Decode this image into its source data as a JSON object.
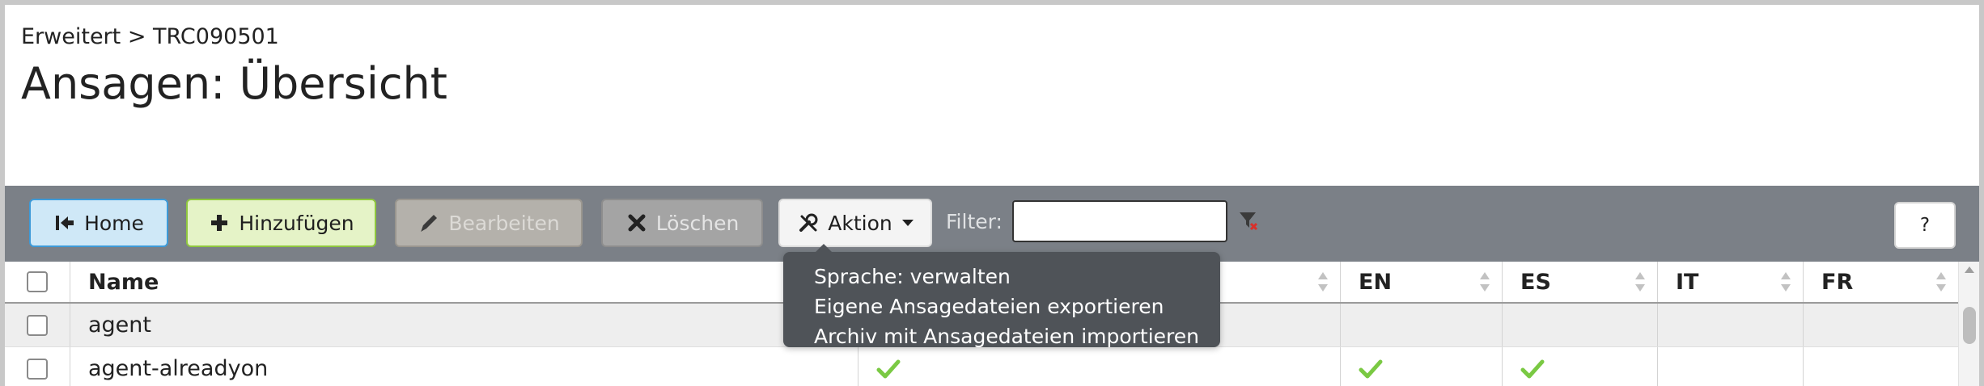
{
  "breadcrumb": "Erweitert > TRC090501",
  "title": "Ansagen: Übersicht",
  "toolbar": {
    "home_label": "Home",
    "add_label": "Hinzufügen",
    "edit_label": "Bearbeiten",
    "delete_label": "Löschen",
    "action_label": "Aktion",
    "filter_label": "Filter:",
    "filter_value": "",
    "help_label": "?"
  },
  "action_menu": [
    "Sprache: verwalten",
    "Eigene Ansagedateien exportieren",
    "Archiv mit Ansagedateien importieren"
  ],
  "table": {
    "columns": [
      "Name",
      "",
      "EN",
      "ES",
      "IT",
      "FR"
    ],
    "rows": [
      {
        "name": "agent",
        "lang1": false,
        "en": false,
        "es": false,
        "it": false,
        "fr": false
      },
      {
        "name": "agent-alreadyon",
        "lang1": true,
        "en": true,
        "es": true,
        "it": false,
        "fr": false
      }
    ]
  },
  "colors": {
    "toolbar_bg": "#7b8087",
    "home_accent": "#3d9ad8",
    "add_accent": "#8fc73e",
    "menu_bg": "#4f5358",
    "checkmark": "#7ac943"
  },
  "icons": {
    "home": "home-first-icon",
    "add": "plus-icon",
    "edit": "pencil-icon",
    "delete": "x-icon",
    "action": "tools-icon",
    "filter": "funnel-clear-icon",
    "sort": "sort-arrows-icon",
    "check": "checkmark-icon"
  }
}
